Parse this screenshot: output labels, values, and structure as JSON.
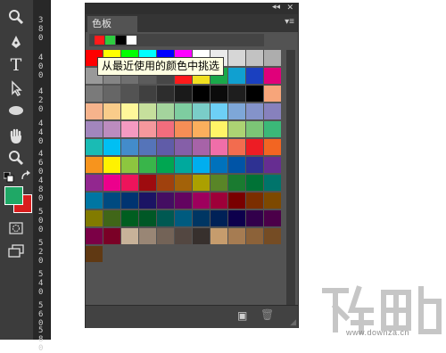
{
  "tools": [
    {
      "name": "zoom-tool-icon"
    },
    {
      "name": "pen-tool-icon"
    },
    {
      "name": "type-tool-icon"
    },
    {
      "name": "path-selection-tool-icon"
    },
    {
      "name": "ellipse-tool-icon"
    },
    {
      "name": "hand-tool-icon"
    },
    {
      "name": "zoom-tool-2-icon"
    }
  ],
  "toolbar": {
    "type_label": "T"
  },
  "colors": {
    "foreground": "#1fa866",
    "background": "#d81d1d"
  },
  "ruler": {
    "labels": [
      "380",
      "400",
      "420",
      "440",
      "460",
      "480",
      "500",
      "520",
      "540",
      "560",
      "580",
      "600"
    ]
  },
  "panel": {
    "tab_label": "色板",
    "collapse_glyph": "◂◂",
    "close_glyph": "✕",
    "menu_glyph": "▾≡",
    "new_swatch_glyph": "▣",
    "delete_glyph": "🗑"
  },
  "recent_colors": [
    "#ff1a1a",
    "#2ecc40",
    "#000000",
    "#ffffff"
  ],
  "swatches": [
    [
      "#ff0000",
      "#ffff00",
      "#00ff00",
      "#00ffff",
      "#0000ff",
      "#ff00ff",
      "#ffffff",
      "#ebebeb",
      "#d6d6d6",
      "#c2c2c2",
      "#adadad"
    ],
    [
      "#999999",
      "#858585",
      "#707070",
      "#5c5c5c",
      "#474747",
      "#ff1a1a",
      "#f0e020",
      "#1aa84a",
      "#10a0d0",
      "#1a40c0",
      "#e0007a"
    ],
    [
      "#7a7a7a",
      "#666666",
      "#535353",
      "#404040",
      "#2d2d2d",
      "#1a1a1a",
      "#000000",
      "#0b0b0b",
      "#1e1e1e",
      "#000000",
      "#f7a57a"
    ],
    [
      "#f6b38c",
      "#f9cc8a",
      "#fff79a",
      "#c6df9c",
      "#a4d49d",
      "#7ecda0",
      "#7acdc8",
      "#6dcff6",
      "#7ea7d8",
      "#8493ca",
      "#8781bd"
    ],
    [
      "#a286bd",
      "#bc8cbf",
      "#f49ac1",
      "#f5989d",
      "#f26d7d",
      "#f68e56",
      "#fbaf5d",
      "#fff467",
      "#acd373",
      "#7cc576",
      "#3bb878"
    ],
    [
      "#1abbb4",
      "#00bff3",
      "#438ccb",
      "#5574b9",
      "#605ca8",
      "#855fa8",
      "#a763a8",
      "#f06ea9",
      "#f26c4f",
      "#ed1c24",
      "#f26522"
    ],
    [
      "#f7941d",
      "#fff200",
      "#8dc63f",
      "#39b54a",
      "#00a651",
      "#00a99d",
      "#00aeef",
      "#0072bc",
      "#0054a6",
      "#2e3192",
      "#662d91"
    ],
    [
      "#92278f",
      "#ec008c",
      "#ed145b",
      "#9e0b0f",
      "#a0410d",
      "#a36209",
      "#aba000",
      "#598527",
      "#1a7b30",
      "#007236",
      "#00746b"
    ],
    [
      "#0076a3",
      "#004a80",
      "#003471",
      "#1b1464",
      "#440e62",
      "#630460",
      "#9e005d",
      "#9e0039",
      "#790000",
      "#7b2e00",
      "#7d4900"
    ],
    [
      "#827b00",
      "#406618",
      "#005e20",
      "#005826",
      "#005952",
      "#005b7f",
      "#003663",
      "#002157",
      "#0d004c",
      "#32004b",
      "#4b0049"
    ],
    [
      "#7b0046",
      "#7a0026",
      "#c7b299",
      "#998675",
      "#736357",
      "#534741",
      "#37302d",
      "#c69c6d",
      "#a67c52",
      "#8c6239",
      "#754c24"
    ],
    [
      "#603913"
    ]
  ],
  "tooltip": "从最近使用的颜色中挑选",
  "watermark": {
    "url": "www.downza.cn"
  }
}
